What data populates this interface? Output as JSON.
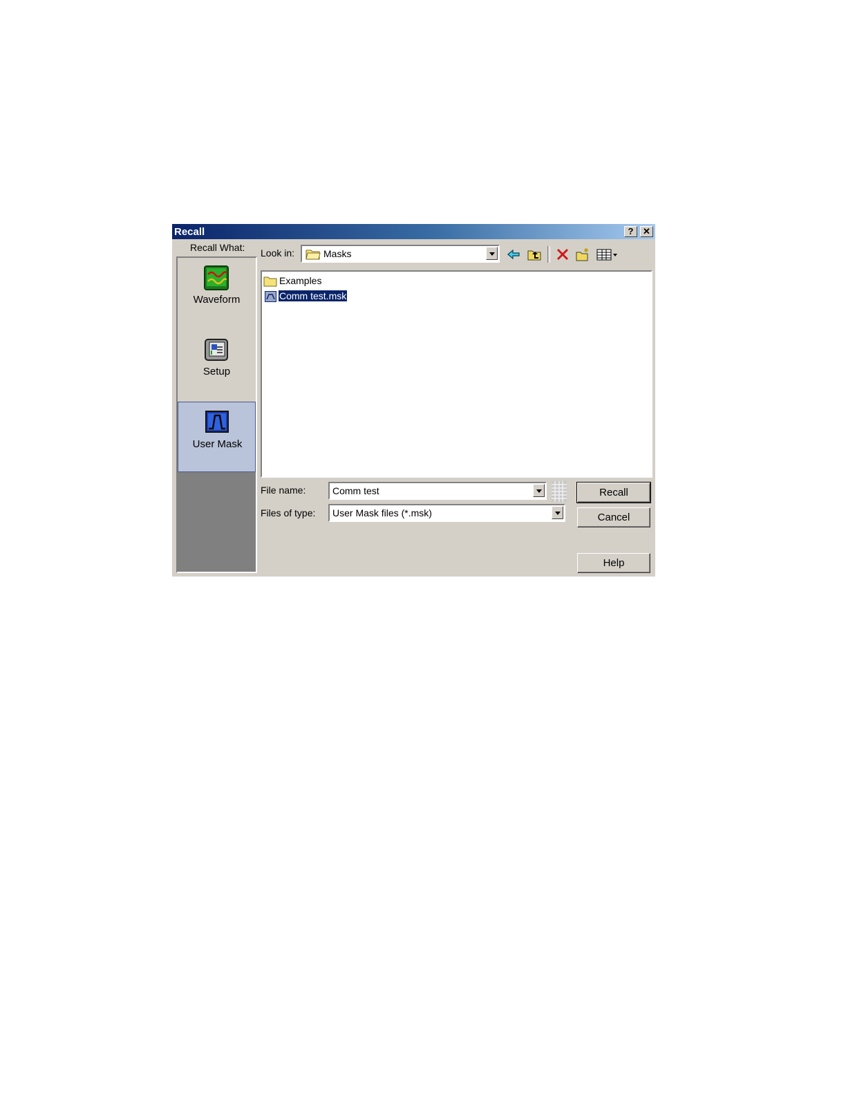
{
  "dialog": {
    "title": "Recall",
    "caption_buttons": {
      "help": "?",
      "close": "✕"
    }
  },
  "recall_what": {
    "label": "Recall What:",
    "items": [
      {
        "label": "Waveform",
        "icon": "waveform-icon"
      },
      {
        "label": "Setup",
        "icon": "setup-icon"
      },
      {
        "label": "User Mask",
        "icon": "user-mask-icon",
        "selected": true
      }
    ]
  },
  "look_in": {
    "label": "Look in:",
    "value": "Masks",
    "toolbar_icons": [
      "back-arrow-icon",
      "up-folder-icon",
      "delete-icon",
      "new-folder-icon",
      "view-menu-icon"
    ]
  },
  "files": [
    {
      "name": "Examples",
      "type": "folder"
    },
    {
      "name": "Comm test.msk",
      "type": "mask-file",
      "selected": true
    }
  ],
  "file_name": {
    "label": "File name:",
    "value": "Comm test"
  },
  "files_of_type": {
    "label": "Files of type:",
    "value": "User Mask files (*.msk)"
  },
  "buttons": {
    "recall": "Recall",
    "cancel": "Cancel",
    "help": "Help"
  },
  "colors": {
    "title_start": "#0a246a",
    "title_end": "#a6caf0",
    "face": "#d4d0c8",
    "selection": "#0a246a"
  }
}
